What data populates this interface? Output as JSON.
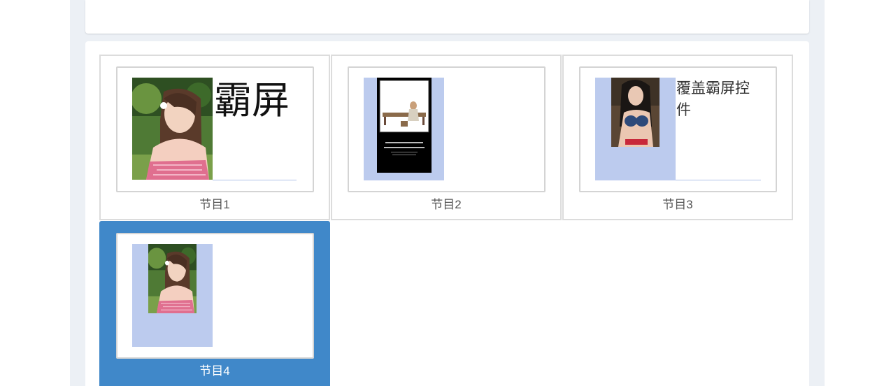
{
  "programs": [
    {
      "label": "节目1",
      "text": "霸屏"
    },
    {
      "label": "节目2",
      "poster_caption_1": "大海般的一整个夏天",
      "poster_caption_2": "你永远不知道你会得到什么"
    },
    {
      "label": "节目3",
      "text": "覆盖霸屏控件"
    },
    {
      "label": "节目4"
    }
  ],
  "colors": {
    "selected": "#4088c9",
    "zone": "#bccbee",
    "page_bg": "#ecf0f5"
  }
}
